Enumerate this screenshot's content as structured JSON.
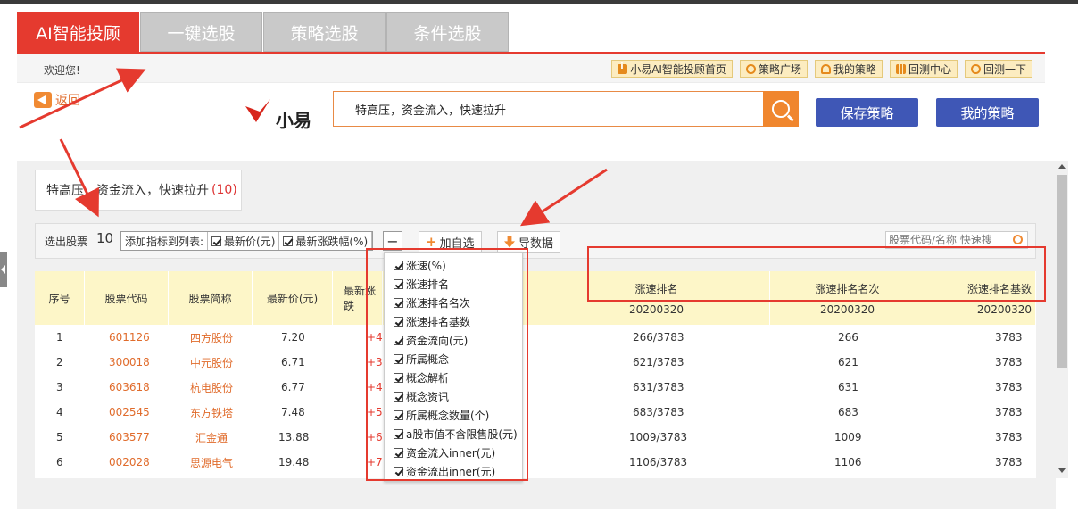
{
  "tabs": [
    {
      "label": "AI智能投顾",
      "active": true
    },
    {
      "label": "一键选股",
      "active": false
    },
    {
      "label": "策略选股",
      "active": false
    },
    {
      "label": "条件选股",
      "active": false
    }
  ],
  "welcome": "欢迎您!",
  "top_links": [
    {
      "label": "小易AI智能投顾首页",
      "icon": "info-icon"
    },
    {
      "label": "策略广场",
      "icon": "bulb-icon"
    },
    {
      "label": "我的策略",
      "icon": "user-icon"
    },
    {
      "label": "回测中心",
      "icon": "chart-icon"
    },
    {
      "label": "回测一下",
      "icon": "stack-icon"
    }
  ],
  "back_label": "返回",
  "logo_text": "小易",
  "search": {
    "value": "特高压，资金流入，快速拉升"
  },
  "buttons": {
    "save_strategy": "保存策略",
    "my_strategy": "我的策略"
  },
  "strategy": {
    "query": "特高压，资金流入，快速拉升",
    "count": "(10)"
  },
  "filter": {
    "selected_label": "选出股票",
    "selected_count": "10",
    "add_to_list_label": "添加指标到列表:",
    "chip1": "最新价(元)",
    "chip2": "最新涨跌幅(%)",
    "minus": "−",
    "add_watch": "加自选",
    "export": "导数据",
    "search_placeholder": "股票代码/名称 快速搜"
  },
  "table": {
    "headers": {
      "idx": "序号",
      "code": "股票代码",
      "name": "股票简称",
      "price": "最新价(元)",
      "change": "最新涨跌",
      "speed_rank": "涨速排名",
      "speed_rank_pos": "涨速排名名次",
      "speed_rank_base": "涨速排名基数",
      "date": "20200320"
    },
    "rows": [
      {
        "idx": "1",
        "code": "601126",
        "name": "四方股份",
        "price": "7.20",
        "change": "+4.",
        "rank": "266/3783",
        "pos": "266",
        "base": "3783"
      },
      {
        "idx": "2",
        "code": "300018",
        "name": "中元股份",
        "price": "6.71",
        "change": "+3.",
        "rank": "621/3783",
        "pos": "621",
        "base": "3783"
      },
      {
        "idx": "3",
        "code": "603618",
        "name": "杭电股份",
        "price": "6.77",
        "change": "+4.",
        "rank": "631/3783",
        "pos": "631",
        "base": "3783"
      },
      {
        "idx": "4",
        "code": "002545",
        "name": "东方铁塔",
        "price": "7.48",
        "change": "+5.",
        "rank": "683/3783",
        "pos": "683",
        "base": "3783"
      },
      {
        "idx": "5",
        "code": "603577",
        "name": "汇金通",
        "price": "13.88",
        "change": "+6.",
        "rank": "1009/3783",
        "pos": "1009",
        "base": "3783"
      },
      {
        "idx": "6",
        "code": "002028",
        "name": "思源电气",
        "price": "19.48",
        "change": "+7.",
        "rank": "1106/3783",
        "pos": "1106",
        "base": "3783"
      }
    ]
  },
  "dropdown_items": [
    "涨速(%)",
    "涨速排名",
    "涨速排名名次",
    "涨速排名基数",
    "资金流向(元)",
    "所属概念",
    "概念解析",
    "概念资讯",
    "所属概念数量(个)",
    "a股市值不含限售股(元)",
    "资金流入inner(元)",
    "资金流出inner(元)"
  ],
  "colors": {
    "accent": "#e53a2f",
    "orange": "#f0862e",
    "blue": "#3f57b6",
    "header_bg": "#fdf6c8"
  }
}
